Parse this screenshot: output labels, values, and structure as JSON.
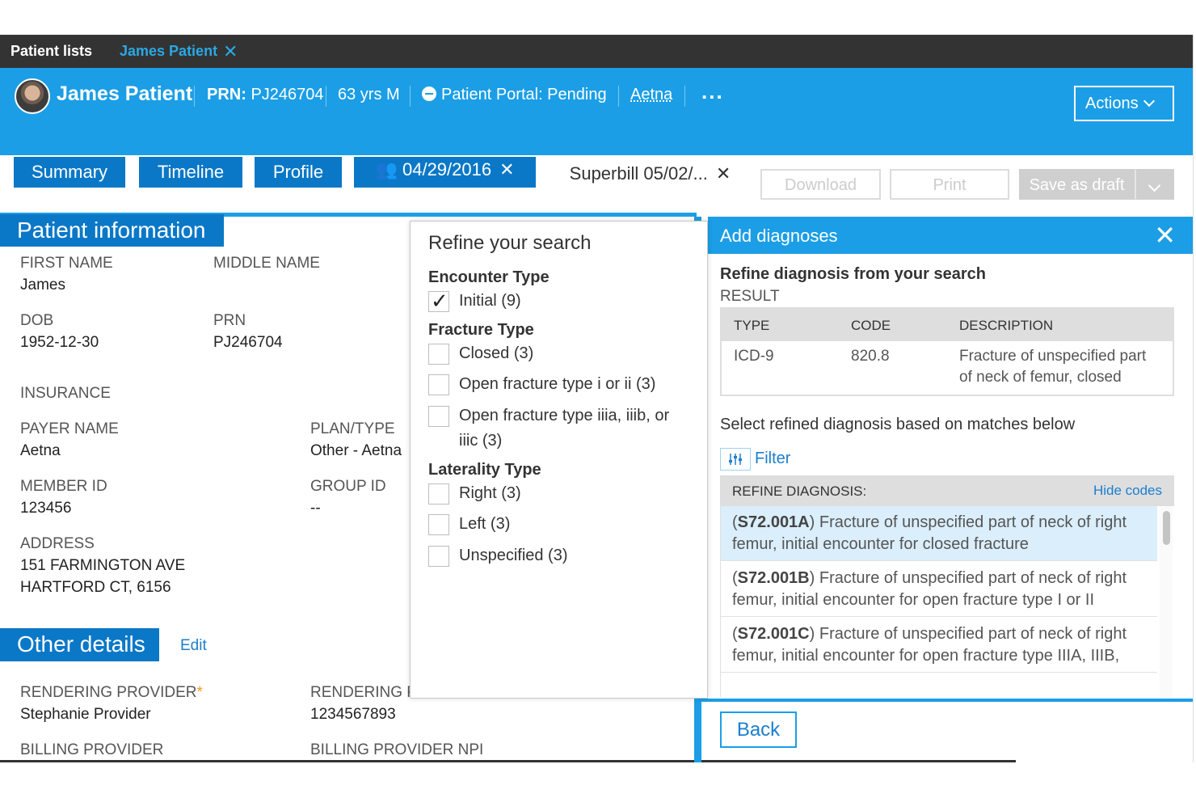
{
  "topbar": {
    "patient_lists": "Patient lists",
    "patient_tab": "James Patient",
    "close": "✕"
  },
  "header": {
    "name": "James Patient",
    "prn_label": "PRN:",
    "prn_value": "PJ246704",
    "age_sex": "63 yrs M",
    "portal": "Patient Portal: Pending",
    "insurer": "Aetna",
    "more": "...",
    "actions": "Actions"
  },
  "tabs": {
    "summary": "Summary",
    "timeline": "Timeline",
    "profile": "Profile",
    "encounter": "04/29/2016",
    "superbill": "Superbill 05/02/...",
    "close": "✕",
    "history_icon": "history-icon",
    "flag_icon": "flag-icon"
  },
  "toolbar": {
    "download": "Download",
    "print": "Print",
    "save_draft": "Save as draft"
  },
  "patient_info": {
    "title": "Patient information",
    "first_name_label": "FIRST NAME",
    "first_name": "James",
    "middle_name_label": "MIDDLE NAME",
    "dob_label": "DOB",
    "dob": "1952-12-30",
    "prn_label": "PRN",
    "prn": "PJ246704",
    "insurance_label": "INSURANCE",
    "payer_name_label": "PAYER NAME",
    "payer_name": "Aetna",
    "plan_type_label": "PLAN/TYPE",
    "plan_type": "Other - Aetna",
    "member_id_label": "MEMBER ID",
    "member_id": "123456",
    "group_id_label": "GROUP ID",
    "group_id": "--",
    "address_label": "ADDRESS",
    "address_line1": "151 FARMINGTON AVE",
    "address_line2": "HARTFORD CT, 6156"
  },
  "other_details": {
    "title": "Other details",
    "edit": "Edit",
    "rendering_provider_label": "RENDERING PROVIDER",
    "required_mark": "*",
    "rendering_provider": "Stephanie Provider",
    "rendering_npi_label": "RENDERING P",
    "rendering_npi": "1234567893",
    "billing_provider_label": "BILLING PROVIDER",
    "billing_npi_label": "BILLING PROVIDER NPI"
  },
  "refine": {
    "title": "Refine your search",
    "encounter_type": "Encounter Type",
    "initial": "Initial (9)",
    "fracture_type": "Fracture Type",
    "closed": "Closed (3)",
    "open_i_ii": "Open fracture type i or ii (3)",
    "open_iii_line1": "Open fracture type iiia, iiib, or",
    "open_iii_line2": "iiic (3)",
    "laterality_type": "Laterality Type",
    "right": "Right (3)",
    "left": "Left (3)",
    "unspecified": "Unspecified (3)"
  },
  "diagnoses": {
    "title": "Add diagnoses",
    "close": "✕",
    "refine_title": "Refine diagnosis from your search",
    "result_label": "RESULT",
    "columns": {
      "type": "TYPE",
      "code": "CODE",
      "description": "DESCRIPTION"
    },
    "result_row": {
      "type": "ICD-9",
      "code": "820.8",
      "desc_line1": "Fracture of unspecified part",
      "desc_line2": "of neck of femur, closed"
    },
    "select_message": "Select refined diagnosis based on matches below",
    "filter": "Filter",
    "refine_header": "REFINE DIAGNOSIS:",
    "hide_codes": "Hide codes",
    "items": [
      {
        "code": "S72.001A",
        "line1": ") Fracture of unspecified part of neck of right",
        "line2": "femur, initial encounter for closed fracture"
      },
      {
        "code": "S72.001B",
        "line1": ") Fracture of unspecified part of neck of right",
        "line2": "femur, initial encounter for open fracture type I or II"
      },
      {
        "code": "S72.001C",
        "line1": ") Fracture of unspecified part of neck of right",
        "line2": "femur, initial encounter for open fracture type IIIA, IIIB,"
      }
    ],
    "back": "Back"
  }
}
